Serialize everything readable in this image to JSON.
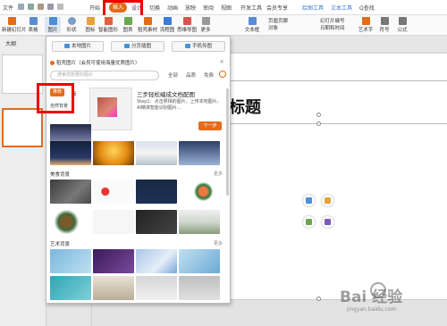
{
  "ribbon": {
    "tabs": [
      "文件",
      "开始",
      "插入",
      "设计",
      "切换",
      "动画",
      "放映",
      "审阅",
      "视图",
      "开发工具",
      "会员专享",
      "绘图工具",
      "文本工具"
    ],
    "active_tab": "插入",
    "search": "Q查找"
  },
  "toolbar": {
    "items": [
      "新建幻灯片",
      "表格",
      "图片",
      "形状",
      "图标",
      "智能图形",
      "图表",
      "稻壳素材",
      "流程图",
      "思维导图",
      "更多",
      "文本框",
      "艺术字",
      "符号",
      "公式"
    ],
    "small": [
      "页眉页脚",
      "幻灯片编号",
      "对象",
      "日期和时间"
    ]
  },
  "left_panel": {
    "tab": "大纲"
  },
  "dropdown": {
    "buttons": [
      "本地图片",
      "分页插图",
      "手机传图"
    ],
    "notice": "稻壳图片（会员可使用海量优质图片）",
    "search_placeholder": "搜索您想要的图片",
    "filters": [
      "全部",
      "品质",
      "免费"
    ],
    "category_active": "推荐",
    "category_other": "商",
    "category_natural": "自然背景",
    "promo": {
      "title": "三步轻松编成文档配图",
      "desc": "Step1：点击照相的图片，上传本地图片，AI精准智能识别图片…",
      "next": "下一步"
    },
    "sections": [
      {
        "title": "美食背景",
        "more": "更多"
      },
      {
        "title": "艺术背景",
        "more": "更多"
      }
    ]
  },
  "slide": {
    "title": "标题"
  },
  "watermark": {
    "brand": "Bai 经验",
    "url": "jingyan.baidu.com"
  }
}
